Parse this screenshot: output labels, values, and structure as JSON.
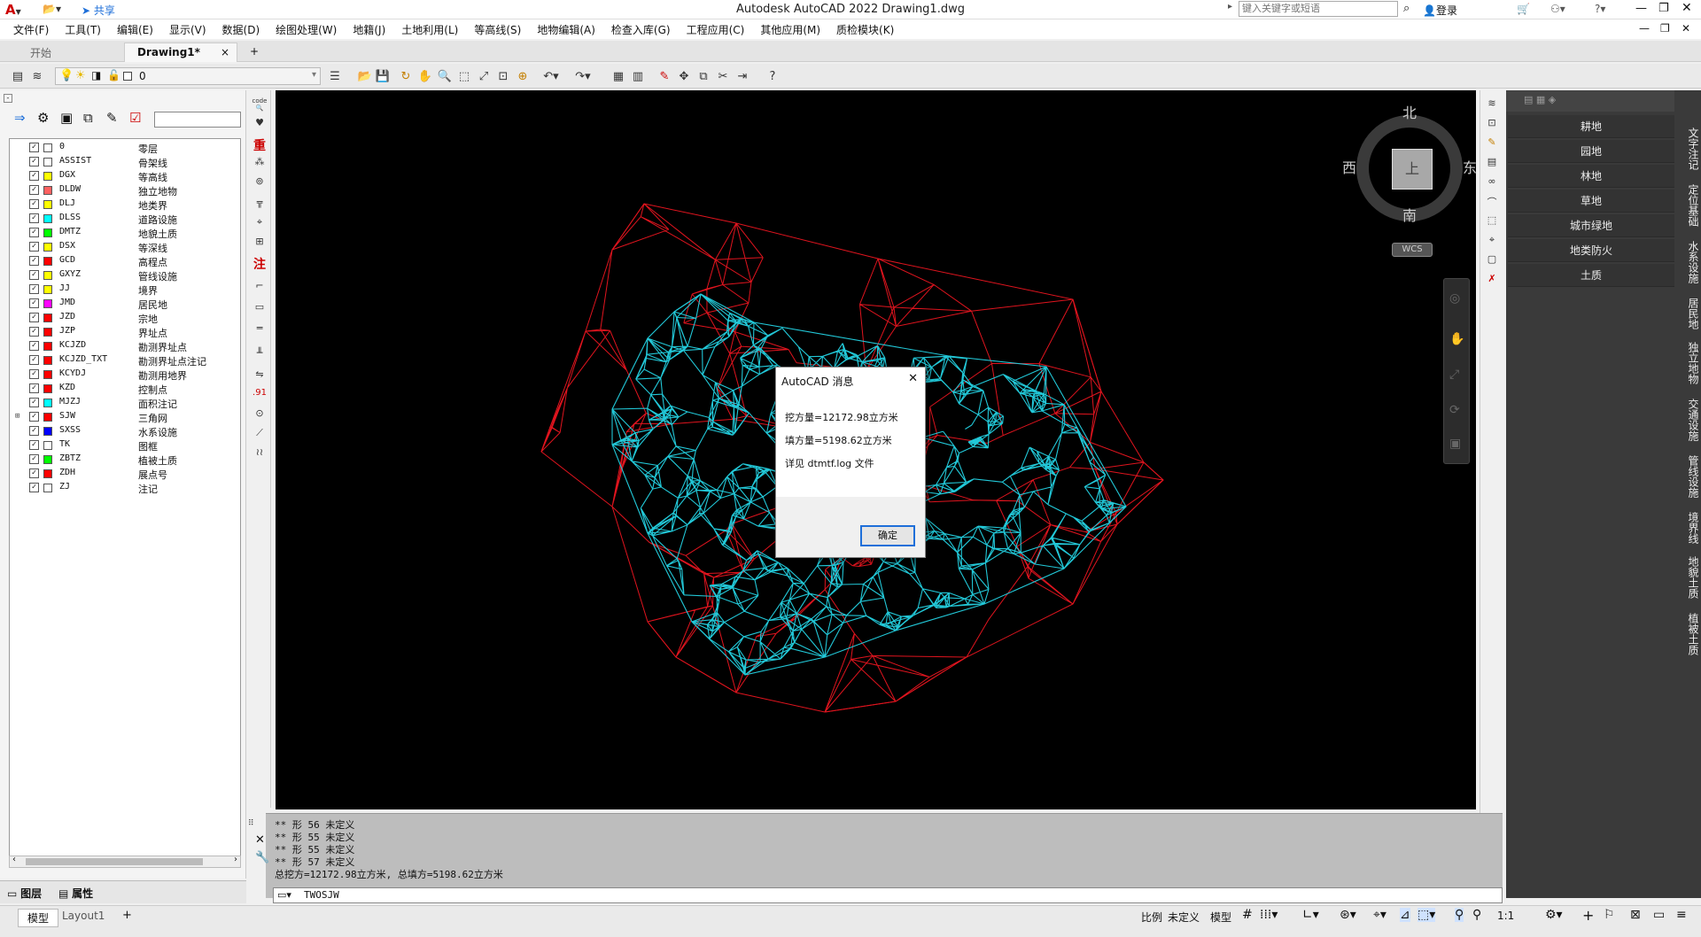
{
  "titlebar": {
    "title": "Autodesk AutoCAD 2022    Drawing1.dwg",
    "share": "共享",
    "search_placeholder": "键入关键字或短语",
    "login": "登录"
  },
  "menu": [
    "文件(F)",
    "工具(T)",
    "编辑(E)",
    "显示(V)",
    "数据(D)",
    "绘图处理(W)",
    "地籍(J)",
    "土地利用(L)",
    "等高线(S)",
    "地物编辑(A)",
    "检查入库(G)",
    "工程应用(C)",
    "其他应用(M)",
    "质检模块(K)"
  ],
  "tabs": {
    "start": "开始",
    "drawing": "Drawing1*",
    "close": "×",
    "add": "+"
  },
  "toolbar": {
    "layer_value": "0"
  },
  "layers": [
    {
      "name": "0",
      "desc": "零层",
      "color": "#ffffff"
    },
    {
      "name": "ASSIST",
      "desc": "骨架线",
      "color": "#ffffff"
    },
    {
      "name": "DGX",
      "desc": "等高线",
      "color": "#ffff00"
    },
    {
      "name": "DLDW",
      "desc": "独立地物",
      "color": "#ff6060"
    },
    {
      "name": "DLJ",
      "desc": "地类界",
      "color": "#ffff00"
    },
    {
      "name": "DLSS",
      "desc": "道路设施",
      "color": "#00ffff"
    },
    {
      "name": "DMTZ",
      "desc": "地貌土质",
      "color": "#00ff00"
    },
    {
      "name": "DSX",
      "desc": "等深线",
      "color": "#ffff00"
    },
    {
      "name": "GCD",
      "desc": "高程点",
      "color": "#ff0000"
    },
    {
      "name": "GXYZ",
      "desc": "管线设施",
      "color": "#ffff00"
    },
    {
      "name": "JJ",
      "desc": "境界",
      "color": "#ffff00"
    },
    {
      "name": "JMD",
      "desc": "居民地",
      "color": "#ff00ff"
    },
    {
      "name": "JZD",
      "desc": "宗地",
      "color": "#ff0000"
    },
    {
      "name": "JZP",
      "desc": "界址点",
      "color": "#ff0000"
    },
    {
      "name": "KCJZD",
      "desc": "勘测界址点",
      "color": "#ff0000"
    },
    {
      "name": "KCJZD_TXT",
      "desc": "勘测界址点注记",
      "color": "#ff0000"
    },
    {
      "name": "KCYDJ",
      "desc": "勘测用地界",
      "color": "#ff0000"
    },
    {
      "name": "KZD",
      "desc": "控制点",
      "color": "#ff0000"
    },
    {
      "name": "MJZJ",
      "desc": "面积注记",
      "color": "#00ffff"
    },
    {
      "name": "SJW",
      "desc": "三角网",
      "color": "#ff0000"
    },
    {
      "name": "SXSS",
      "desc": "水系设施",
      "color": "#0000ff"
    },
    {
      "name": "TK",
      "desc": "图框",
      "color": "#ffffff"
    },
    {
      "name": "ZBTZ",
      "desc": "植被土质",
      "color": "#00ff00"
    },
    {
      "name": "ZDH",
      "desc": "展点号",
      "color": "#ff0000"
    },
    {
      "name": "ZJ",
      "desc": "注记",
      "color": "#ffffff"
    }
  ],
  "panel_tabs": {
    "layers": "图层",
    "props": "属性"
  },
  "viewcube": {
    "north": "北",
    "south": "南",
    "east": "东",
    "west": "西",
    "top": "上",
    "wcs": "WCS"
  },
  "palette": {
    "items": [
      "耕地",
      "园地",
      "林地",
      "草地",
      "城市绿地",
      "地类防火",
      "土质"
    ],
    "vtabs": [
      "文字注记",
      "定位基础",
      "水系设施",
      "居民地",
      "独立地物",
      "交通设施",
      "管线设施",
      "境界线",
      "地貌土质",
      "植被土质"
    ]
  },
  "dialog": {
    "title": "AutoCAD 消息",
    "line1": "挖方量=12172.98立方米",
    "line2": "填方量=5198.62立方米",
    "line3": "详见 dtmtf.log 文件",
    "ok": "确定"
  },
  "cmd": {
    "history": [
      "** 形 56 未定义",
      "** 形 55 未定义",
      "** 形 55 未定义",
      "** 形 57 未定义",
      "总挖方=12172.98立方米, 总填方=5198.62立方米"
    ],
    "current": "TWOSJW"
  },
  "status": {
    "model": "模型",
    "layout": "Layout1",
    "scale_label": "比例",
    "scale_value": "未定义",
    "model_btn": "模型",
    "ratio": "1:1"
  },
  "colors": {
    "tin_cyan": "#22c8d8",
    "tin_red": "#e0141e"
  }
}
